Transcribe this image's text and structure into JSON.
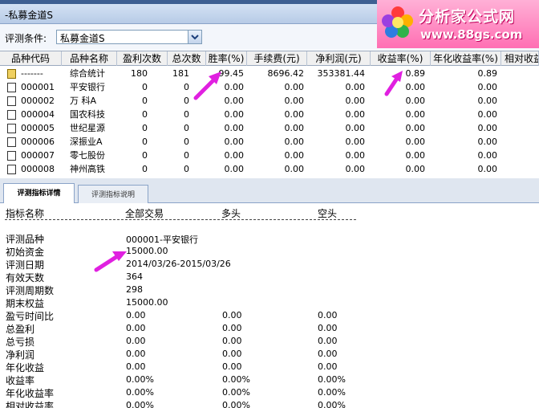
{
  "window": {
    "title": "-私募金道S"
  },
  "logo": {
    "brand": "分析家公式网",
    "url": "www.88gs.com"
  },
  "condition": {
    "label": "评测条件:",
    "selected": "私募金道S"
  },
  "colors": {
    "accent_arrow": "#e020e0",
    "header_bg": "#f0f0f0",
    "title_bg": "#c8d8ee"
  },
  "table": {
    "headers": [
      "品种代码",
      "品种名称",
      "盈利次数",
      "总次数",
      "胜率(%)",
      "手续费(元)",
      "净利润(元)",
      "收益率(%)",
      "年化收益率(%)",
      "相对收益"
    ],
    "rows": [
      {
        "code": "-------",
        "name": "综合统计",
        "win": "180",
        "total": "181",
        "rate": "99.45",
        "fee": "8696.42",
        "profit": "353381.44",
        "yield": "0.89",
        "ann": "0.89",
        "icon": "folder-icon"
      },
      {
        "code": "000001",
        "name": "平安银行",
        "win": "0",
        "total": "0",
        "rate": "0.00",
        "fee": "0.00",
        "profit": "0.00",
        "yield": "0.00",
        "ann": "0.00",
        "icon": "document-icon"
      },
      {
        "code": "000002",
        "name": "万 科A",
        "win": "0",
        "total": "0",
        "rate": "0.00",
        "fee": "0.00",
        "profit": "0.00",
        "yield": "0.00",
        "ann": "0.00",
        "icon": "document-icon"
      },
      {
        "code": "000004",
        "name": "国农科技",
        "win": "0",
        "total": "0",
        "rate": "0.00",
        "fee": "0.00",
        "profit": "0.00",
        "yield": "0.00",
        "ann": "0.00",
        "icon": "document-icon"
      },
      {
        "code": "000005",
        "name": "世纪星源",
        "win": "0",
        "total": "0",
        "rate": "0.00",
        "fee": "0.00",
        "profit": "0.00",
        "yield": "0.00",
        "ann": "0.00",
        "icon": "document-icon"
      },
      {
        "code": "000006",
        "name": "深振业A",
        "win": "0",
        "total": "0",
        "rate": "0.00",
        "fee": "0.00",
        "profit": "0.00",
        "yield": "0.00",
        "ann": "0.00",
        "icon": "document-icon"
      },
      {
        "code": "000007",
        "name": "零七股份",
        "win": "0",
        "total": "0",
        "rate": "0.00",
        "fee": "0.00",
        "profit": "0.00",
        "yield": "0.00",
        "ann": "0.00",
        "icon": "document-icon"
      },
      {
        "code": "000008",
        "name": "神州高铁",
        "win": "0",
        "total": "0",
        "rate": "0.00",
        "fee": "0.00",
        "profit": "0.00",
        "yield": "0.00",
        "ann": "0.00",
        "icon": "document-icon"
      }
    ]
  },
  "tabs": [
    {
      "label": "评测指标详情",
      "active": true
    },
    {
      "label": "评测指标说明",
      "active": false
    }
  ],
  "detail": {
    "headers": [
      "指标名称",
      "全部交易",
      "多头",
      "空头"
    ],
    "rows": [
      {
        "name": "评测品种",
        "all": "000001-平安银行",
        "long": "",
        "short": ""
      },
      {
        "name": "初始资金",
        "all": "15000.00",
        "long": "",
        "short": ""
      },
      {
        "name": "评测日期",
        "all": "2014/03/26-2015/03/26",
        "long": "",
        "short": ""
      },
      {
        "name": "有效天数",
        "all": "364",
        "long": "",
        "short": ""
      },
      {
        "name": "评测周期数",
        "all": "298",
        "long": "",
        "short": ""
      },
      {
        "name": "期末权益",
        "all": "15000.00",
        "long": "",
        "short": ""
      },
      {
        "name": "盈亏时间比",
        "all": "0.00",
        "long": "0.00",
        "short": "0.00"
      },
      {
        "name": "总盈利",
        "all": "0.00",
        "long": "0.00",
        "short": "0.00"
      },
      {
        "name": "总亏损",
        "all": "0.00",
        "long": "0.00",
        "short": "0.00"
      },
      {
        "name": "净利润",
        "all": "0.00",
        "long": "0.00",
        "short": "0.00"
      },
      {
        "name": "年化收益",
        "all": "0.00",
        "long": "0.00",
        "short": "0.00"
      },
      {
        "name": "收益率",
        "all": "0.00%",
        "long": "0.00%",
        "short": "0.00%"
      },
      {
        "name": "年化收益率",
        "all": "0.00%",
        "long": "0.00%",
        "short": "0.00%"
      },
      {
        "name": "相对收益率",
        "all": "0.00%",
        "long": "0.00%",
        "short": "0.00%"
      }
    ]
  }
}
